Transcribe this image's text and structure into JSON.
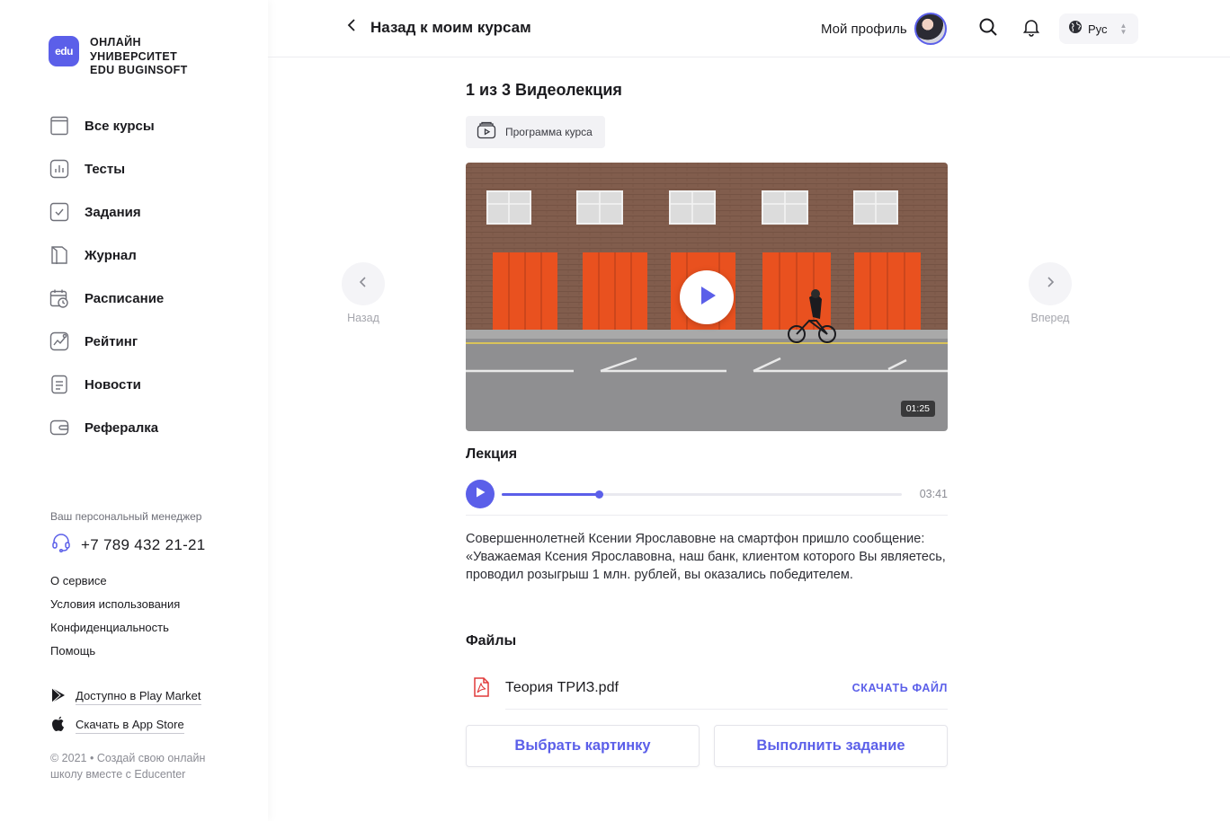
{
  "brand": {
    "badge": "edu",
    "name_lines": [
      "ОНЛАЙН",
      "УНИВЕРСИТЕТ",
      "EDU BUGINSOFT"
    ]
  },
  "sidebar": {
    "items": [
      {
        "label": "Все курсы",
        "icon": "book-icon"
      },
      {
        "label": "Тесты",
        "icon": "chart-icon"
      },
      {
        "label": "Задания",
        "icon": "checkbox-icon"
      },
      {
        "label": "Журнал",
        "icon": "journal-icon"
      },
      {
        "label": "Расписание",
        "icon": "calendar-clock-icon"
      },
      {
        "label": "Рейтинг",
        "icon": "trend-icon"
      },
      {
        "label": "Новости",
        "icon": "document-icon"
      },
      {
        "label": "Рефералка",
        "icon": "wallet-icon"
      }
    ],
    "manager_label": "Ваш персональный  менеджер",
    "phone": "+7 789 432 21-21",
    "links": [
      "О сервисе",
      "Условия использования",
      "Конфиденциальность",
      "Помощь"
    ],
    "play_market": "Доступно в Play Market",
    "app_store": "Скачать в App Store",
    "copyright": "© 2021 • Создай свою онлайн школу вместе с Educenter"
  },
  "header": {
    "back_label": "Назад к моим курсам",
    "profile_label": "Мой профиль",
    "language": "Рус"
  },
  "lesson": {
    "title": "1 из 3 Видеолекция",
    "program_button": "Программа курса",
    "video_duration": "01:25",
    "prev_label": "Назад",
    "next_label": "Вперед",
    "audio_title": "Лекция",
    "audio_time": "03:41",
    "audio_progress": 0.243,
    "description": "Совершеннолетней Ксении Ярославовне на смартфон пришло сообщение: «Уважаемая Ксения Ярославовна, наш банк, клиентом которого Вы являетесь, проводил розыгрыш 1 млн. рублей, вы оказались победителем.",
    "files_title": "Файлы",
    "file_name": "Теория ТРИЗ.pdf",
    "download_label": "СКАЧАТЬ ФАЙЛ",
    "choose_picture": "Выбрать картинку",
    "do_task": "Выполнить задание"
  },
  "colors": {
    "accent": "#5b5fe9",
    "pdf_red": "#e03a3a"
  }
}
